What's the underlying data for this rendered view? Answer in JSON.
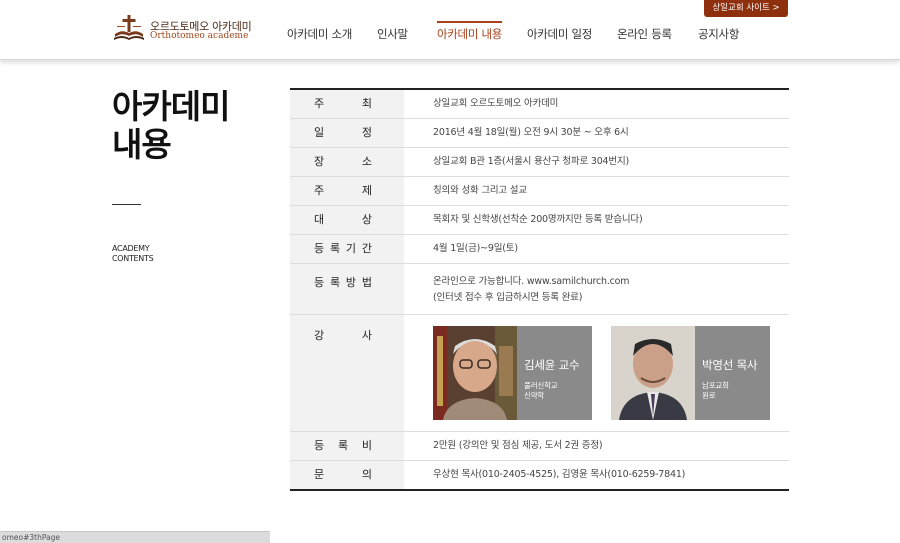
{
  "header": {
    "logo": {
      "name_kr": "오르도토메오 아카데미",
      "name_en": "Orthotomeo academe"
    },
    "site_button": "상일교회 사이트 >",
    "nav": [
      {
        "label": "아카데미 소개",
        "active": false
      },
      {
        "label": "인사말",
        "active": false
      },
      {
        "label": "아카데미 내용",
        "active": true
      },
      {
        "label": "아카데미 일정",
        "active": false
      },
      {
        "label": "온라인 등록",
        "active": false
      },
      {
        "label": "공지사항",
        "active": false
      }
    ]
  },
  "sidebar": {
    "title_line1": "아카데미",
    "title_line2": "내용",
    "sub_line1": "ACADEMY",
    "sub_line2": "CONTENTS"
  },
  "info": {
    "host": {
      "label": [
        "주",
        "최"
      ],
      "value": "상일교회 오르도토메오 아카데미"
    },
    "date": {
      "label": [
        "일",
        "정"
      ],
      "value": "2016년 4월 18일(월) 오전 9시 30분 ~ 오후 6시"
    },
    "place": {
      "label": [
        "장",
        "소"
      ],
      "value": "상일교회 B관 1층(서울시 용산구 청파로 304번지)"
    },
    "theme": {
      "label": [
        "주",
        "제"
      ],
      "value": "칭의와 성화 그리고 설교"
    },
    "target": {
      "label": [
        "대",
        "상"
      ],
      "value": "목회자 및 신학생(선착순 200명까지만 등록 받습니다)"
    },
    "period": {
      "label": [
        "등",
        "록",
        "기",
        "간"
      ],
      "value": "4월 1일(금)~9일(토)"
    },
    "method": {
      "label": [
        "등",
        "록",
        "방",
        "법"
      ],
      "value_line1": "온라인으로 가능합니다. www.samilchurch.com",
      "value_line2": "(인터넷 접수 후 입금하시면 등록 완료)"
    },
    "lecturers": {
      "label": [
        "강",
        "사"
      ],
      "people": [
        {
          "name": "김세윤 교수",
          "desc_line1": "풀러신학교",
          "desc_line2": "신약학"
        },
        {
          "name": "박영선 목사",
          "desc_line1": "남포교회",
          "desc_line2": "원로"
        }
      ]
    },
    "fee": {
      "label": [
        "등",
        "록",
        "비"
      ],
      "value": "2만원 (강의안 및 점심 제공, 도서 2권 증정)"
    },
    "contact": {
      "label": [
        "문",
        "의"
      ],
      "value": "우상현 목사(010-2405-4525), 김영윤 목사(010-6259-7841)"
    }
  },
  "status_bar": "omeo#3thPage",
  "colors": {
    "accent": "#a8401a",
    "button": "#8e2f0e",
    "card": "#8a8a8a",
    "label_bg": "#f2f2f2"
  }
}
